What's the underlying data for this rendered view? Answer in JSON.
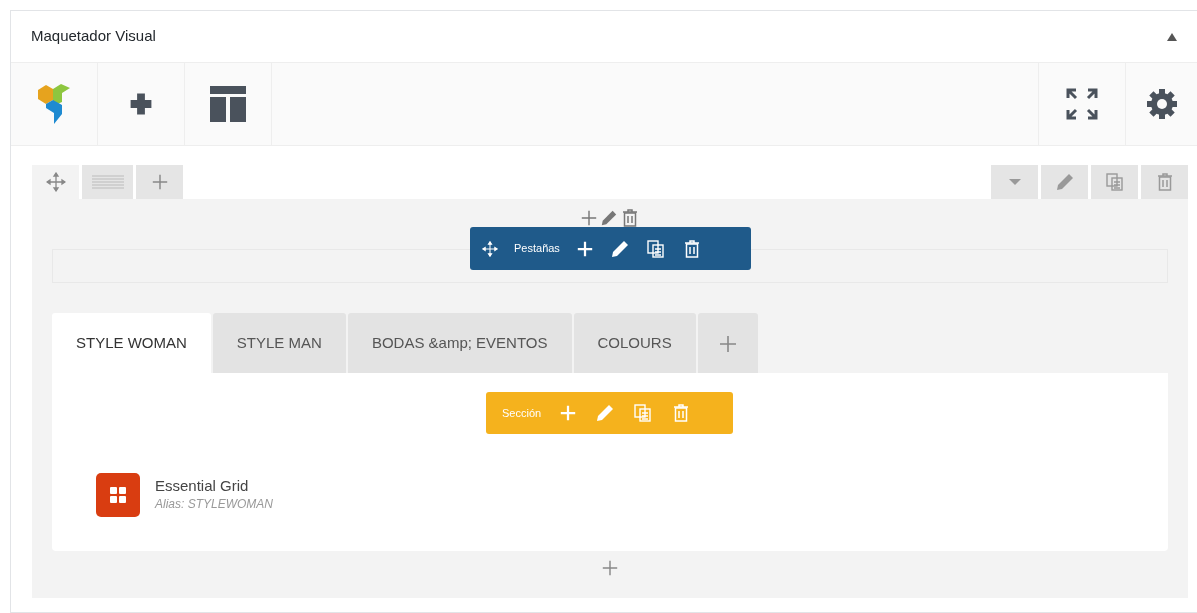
{
  "panel": {
    "title": "Maquetador Visual",
    "expanded": true
  },
  "tabs_element": {
    "label": "Pestañas"
  },
  "tabs": [
    {
      "label": "STYLE WOMAN",
      "selected": true
    },
    {
      "label": "STYLE MAN",
      "selected": false
    },
    {
      "label": "BODAS &amp; EVENTOS",
      "selected": false
    },
    {
      "label": "COLOURS",
      "selected": false
    }
  ],
  "section": {
    "label": "Sección"
  },
  "element": {
    "name": "Essential Grid",
    "alias": "Alias: STYLEWOMAN"
  }
}
